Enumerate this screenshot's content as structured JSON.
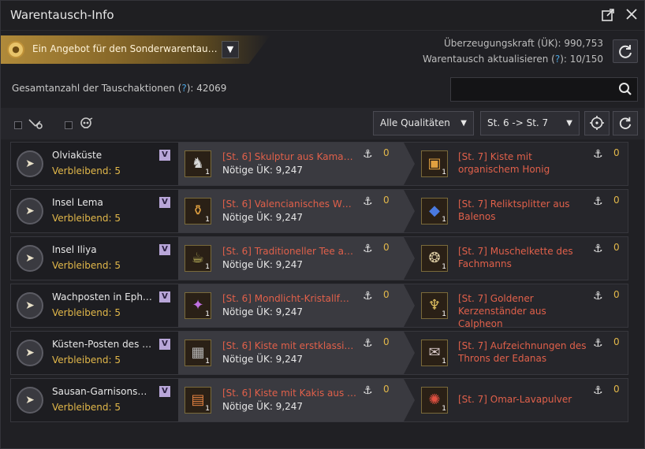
{
  "window": {
    "title": "Warentausch-Info"
  },
  "titlebar": {
    "popout_icon": "popout-icon",
    "close_icon": "close-icon"
  },
  "offer": {
    "text": "Ein Angebot für den Sonderwarentau…",
    "dropdown_glyph": "▼",
    "icon": "coin-icon"
  },
  "stats": {
    "persuasion_label": "Überzeugungskraft (ÜK):",
    "persuasion_value": "990,753",
    "refresh_label_pre": "Warentausch aktualisieren (",
    "refresh_help": "?",
    "refresh_label_post": "):",
    "refresh_value": "10/150"
  },
  "total": {
    "label_pre": "Gesamtanzahl der Tauschaktionen (",
    "help": "?",
    "label_post": "):",
    "value": "42069"
  },
  "search": {
    "value": "",
    "placeholder": ""
  },
  "filters": {
    "quality_select": "Alle Qualitäten",
    "tier_select": "St. 6 -> St. 7",
    "caret": "▼"
  },
  "rows": [
    {
      "location": "Olviaküste",
      "remaining": "Verbleibend: 5",
      "badge": "V",
      "give_item": "[St. 6] Skulptur aus Kama…",
      "give_uek": "Nötige ÜK: 9,247",
      "give_qty": "1",
      "give_anchor": "0",
      "recv_item": "[St. 7] Kiste mit organischem Honig",
      "recv_qty": "1",
      "recv_anchor": "0"
    },
    {
      "location": "Insel Lema",
      "remaining": "Verbleibend: 5",
      "badge": "V",
      "give_item": "[St. 6] Valencianisches W…",
      "give_uek": "Nötige ÜK: 9,247",
      "give_qty": "1",
      "give_anchor": "0",
      "recv_item": "[St. 7] Reliktsplitter aus Balenos",
      "recv_qty": "1",
      "recv_anchor": "0"
    },
    {
      "location": "Insel Iliya",
      "remaining": "Verbleibend: 5",
      "badge": "V",
      "give_item": "[St. 6] Traditioneller Tee a…",
      "give_uek": "Nötige ÜK: 9,247",
      "give_qty": "1",
      "give_anchor": "0",
      "recv_item": "[St. 7] Muschelkette des Fachmanns",
      "recv_qty": "1",
      "recv_anchor": "0"
    },
    {
      "location": "Wachposten in Eph…",
      "remaining": "Verbleibend: 5",
      "badge": "V",
      "give_item": "[St. 6] Mondlicht-Kristallf…",
      "give_uek": "Nötige ÜK: 9,247",
      "give_qty": "1",
      "give_anchor": "0",
      "recv_item": "[St. 7] Goldener Kerzenständer aus Calpheon",
      "recv_qty": "1",
      "recv_anchor": "0"
    },
    {
      "location": "Küsten-Posten des …",
      "remaining": "Verbleibend: 5",
      "badge": "V",
      "give_item": "[St. 6] Kiste mit erstklassi…",
      "give_uek": "Nötige ÜK: 9,247",
      "give_qty": "1",
      "give_anchor": "0",
      "recv_item": "[St. 7] Aufzeichnungen des Throns der Edanas",
      "recv_qty": "1",
      "recv_anchor": "0"
    },
    {
      "location": "Sausan-Garnisons…",
      "remaining": "Verbleibend: 5",
      "badge": "V",
      "give_item": "[St. 6] Kiste mit Kakis aus …",
      "give_uek": "Nötige ÜK: 9,247",
      "give_qty": "1",
      "give_anchor": "0",
      "recv_item": "[St. 7] Omar-Lavapulver",
      "recv_qty": "1",
      "recv_anchor": "0"
    }
  ],
  "colors": {
    "accent_gold": "#e2b84a",
    "item_red": "#e0604a",
    "help_blue": "#4aa3e0",
    "badge_purple": "#b8a6d8"
  }
}
